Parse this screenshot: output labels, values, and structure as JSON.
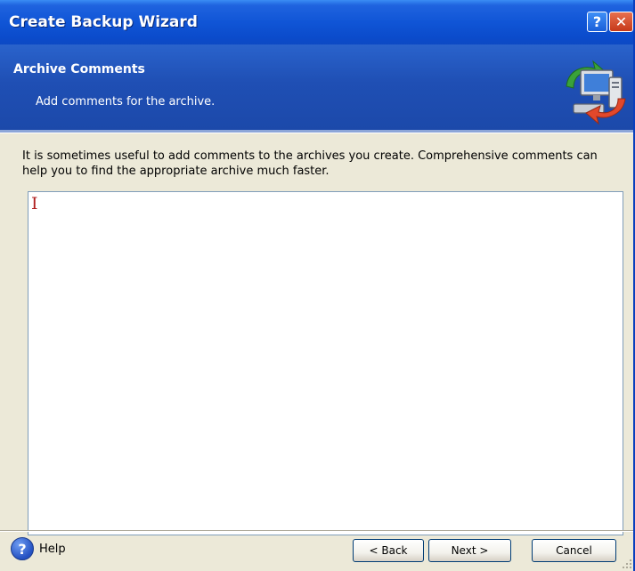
{
  "window": {
    "title": "Create Backup Wizard",
    "help_glyph": "?",
    "close_glyph": "✕"
  },
  "header": {
    "title": "Archive Comments",
    "subtitle": "Add comments for the archive.",
    "icon": "backup-computer-icon"
  },
  "body": {
    "description": "It is sometimes useful to add comments to the archives you create. Comprehensive comments can help you to find the appropriate archive much faster.",
    "comment_value": "",
    "cursor_glyph": "I"
  },
  "footer": {
    "help_label": "Help",
    "help_glyph": "?",
    "back_label": "< Back",
    "next_label": "Next >",
    "cancel_label": "Cancel"
  },
  "colors": {
    "titlebar": "#0b4bcb",
    "header": "#1f4fb4",
    "dialog_bg": "#ece9d8",
    "close_button": "#c6391a"
  }
}
